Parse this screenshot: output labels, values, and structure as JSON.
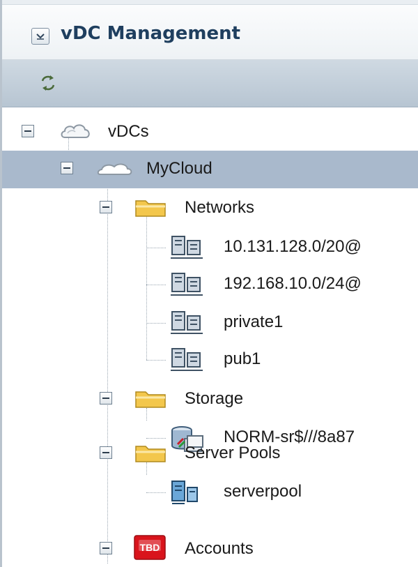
{
  "panel": {
    "title": "vDC Management"
  },
  "tree": {
    "root_label": "vDCs",
    "cloud_label": "MyCloud",
    "networks": {
      "label": "Networks",
      "items": [
        "10.131.128.0/20@",
        "192.168.10.0/24@",
        "private1",
        "pub1"
      ]
    },
    "storage": {
      "label": "Storage",
      "items": [
        "NORM-sr$///8a87"
      ]
    },
    "server_pools": {
      "label": "Server Pools",
      "items": [
        "serverpool"
      ]
    },
    "accounts": {
      "label": "Accounts",
      "badge": "TBD"
    }
  },
  "colors": {
    "title": "#1f3f5f",
    "selected_row": "#a9b9cc",
    "toolbar": "#c3cfdb",
    "folder": "#f3c74c",
    "badge": "#d9141c"
  },
  "icons": {
    "collapse": "chevron-down-icon",
    "refresh": "refresh-icon",
    "cloud": "cloud-icon",
    "folder": "folder-icon",
    "network": "network-icon",
    "storage": "storage-icon",
    "server_pool": "server-pool-icon",
    "accounts": "tbd-icon"
  }
}
